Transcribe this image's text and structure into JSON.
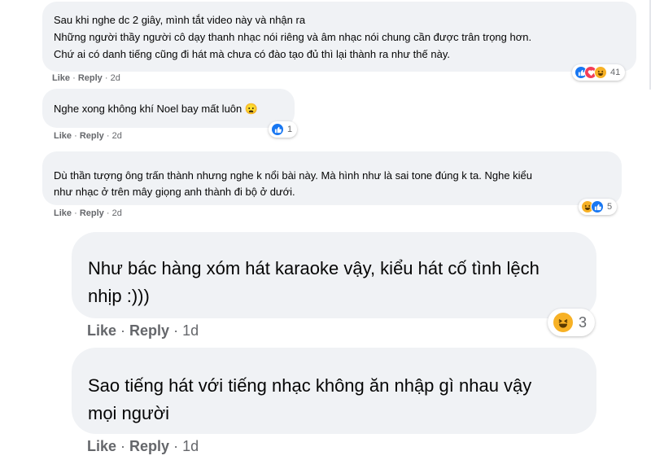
{
  "comments": [
    {
      "text": "Sau khi nghe dc 2 giây, mình tắt video này và nhận ra\nNhững người thầy người cô dạy thanh nhạc nói riêng và âm nhạc nói chung cần được trân trọng hơn.\nChứ ai có danh tiếng cũng đi hát mà chưa có đào tạo đủ thì lại thành ra như thế này.",
      "like": "Like",
      "reply": "Reply",
      "time": "2d",
      "reaction_count": "41",
      "reactions": [
        "like-icon",
        "love-icon",
        "haha-icon"
      ]
    },
    {
      "text": "Nghe xong không khí Noel bay mất luôn 😦",
      "like": "Like",
      "reply": "Reply",
      "time": "2d",
      "reaction_count": "1",
      "reactions": [
        "like-icon"
      ]
    },
    {
      "text": "Dù thần tượng ông trấn thành nhưng nghe k nổi bài này. Mà hình như là sai tone đúng k ta. Nghe kiểu\nnhư nhạc ở trên mây giọng anh thành đi bộ ở dưới.",
      "like": "Like",
      "reply": "Reply",
      "time": "2d",
      "reaction_count": "5",
      "reactions": [
        "haha-icon",
        "like-icon"
      ]
    },
    {
      "text": "Như bác hàng xóm hát karaoke vậy, kiểu hát cố tình lệch\nnhịp :)))",
      "like": "Like",
      "reply": "Reply",
      "time": "1d",
      "reaction_count": "3",
      "reactions": [
        "haha-icon"
      ]
    },
    {
      "text": "Sao tiếng hát với tiếng nhạc không ăn nhập gì nhau vậy\nmọi người",
      "like": "Like",
      "reply": "Reply",
      "time": "1d"
    }
  ],
  "colors": {
    "bubble": "#f0f2f5",
    "meta_text": "#65676b",
    "like_blue": "#1877f2",
    "love_red": "#f33e58",
    "haha_yellow": "#f7b125"
  }
}
